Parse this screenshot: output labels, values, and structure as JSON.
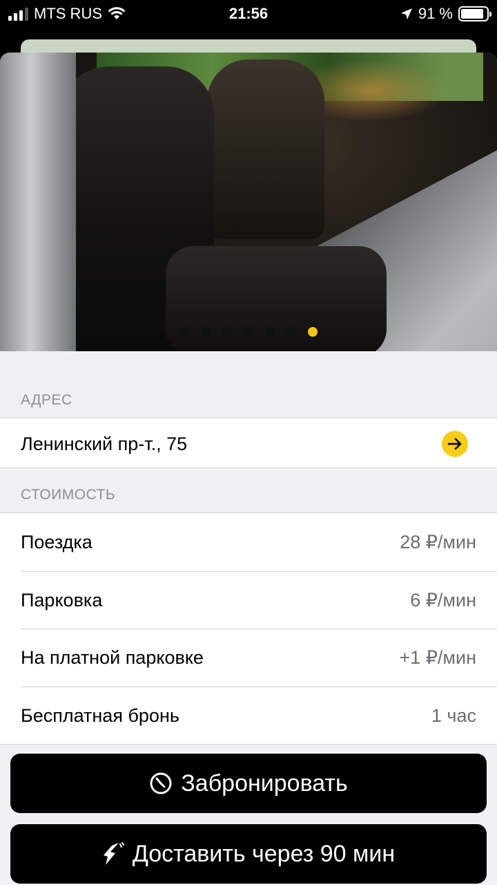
{
  "status_bar": {
    "carrier": "MTS RUS",
    "time": "21:56",
    "battery": "91 %",
    "battery_level": 0.91
  },
  "gallery": {
    "page_count": 7,
    "active_page": 7,
    "active_color": "#f5c518"
  },
  "address": {
    "section_title": "АДРЕС",
    "text": "Ленинский пр-т., 75",
    "action_icon": "arrow-right-icon",
    "accent": "#f8cc1b"
  },
  "cost": {
    "section_title": "СТОИМОСТЬ",
    "rows": [
      {
        "label": "Поездка",
        "value": "28 ₽/мин"
      },
      {
        "label": "Парковка",
        "value": "6 ₽/мин"
      },
      {
        "label": "На платной парковке",
        "value": "+1 ₽/мин"
      },
      {
        "label": "Бесплатная бронь",
        "value": "1 час"
      }
    ]
  },
  "buttons": {
    "book": {
      "label": "Забронировать",
      "icon": "clock-icon"
    },
    "deliver": {
      "label": "Доставить через 90 мин",
      "icon": "lightning-icon"
    }
  }
}
